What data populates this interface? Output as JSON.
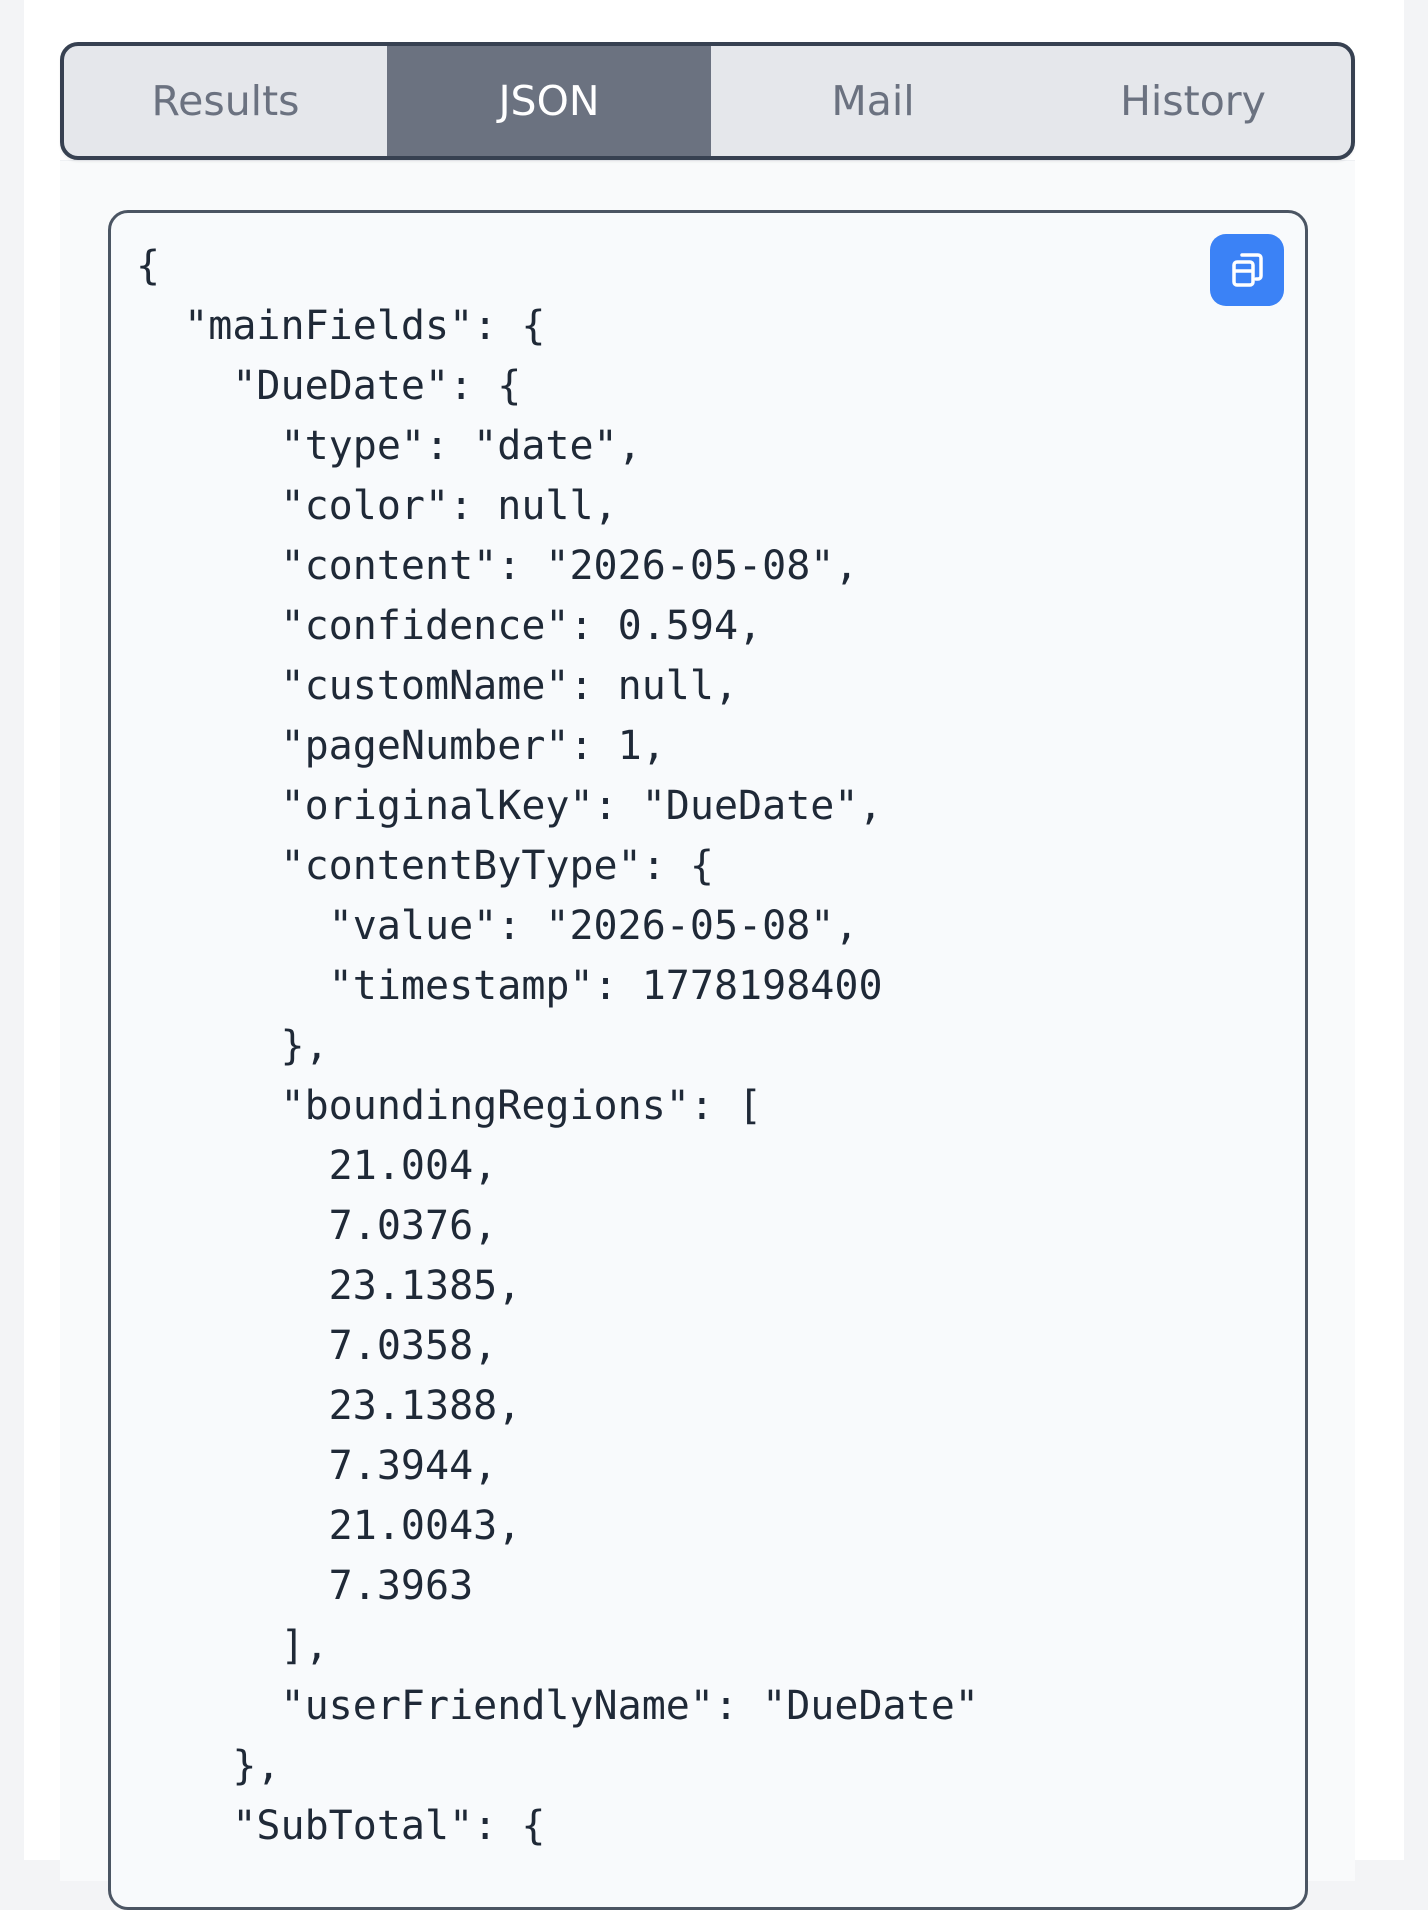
{
  "tabs": [
    {
      "label": "Results",
      "active": false
    },
    {
      "label": "JSON",
      "active": true
    },
    {
      "label": "Mail",
      "active": false
    },
    {
      "label": "History",
      "active": false
    }
  ],
  "code": {
    "copy_icon": "copy-icon",
    "lines": [
      "{",
      "  \"mainFields\": {",
      "    \"DueDate\": {",
      "      \"type\": \"date\",",
      "      \"color\": null,",
      "      \"content\": \"2026-05-08\",",
      "      \"confidence\": 0.594,",
      "      \"customName\": null,",
      "      \"pageNumber\": 1,",
      "      \"originalKey\": \"DueDate\",",
      "      \"contentByType\": {",
      "        \"value\": \"2026-05-08\",",
      "        \"timestamp\": 1778198400",
      "      },",
      "      \"boundingRegions\": [",
      "        21.004,",
      "        7.0376,",
      "        23.1385,",
      "        7.0358,",
      "        23.1388,",
      "        7.3944,",
      "        21.0043,",
      "        7.3963",
      "      ],",
      "      \"userFriendlyName\": \"DueDate\"",
      "    },",
      "    \"SubTotal\": {"
    ]
  },
  "colors": {
    "active_tab": "#6b7280",
    "copy_button": "#3b82f6",
    "border": "#374151"
  }
}
